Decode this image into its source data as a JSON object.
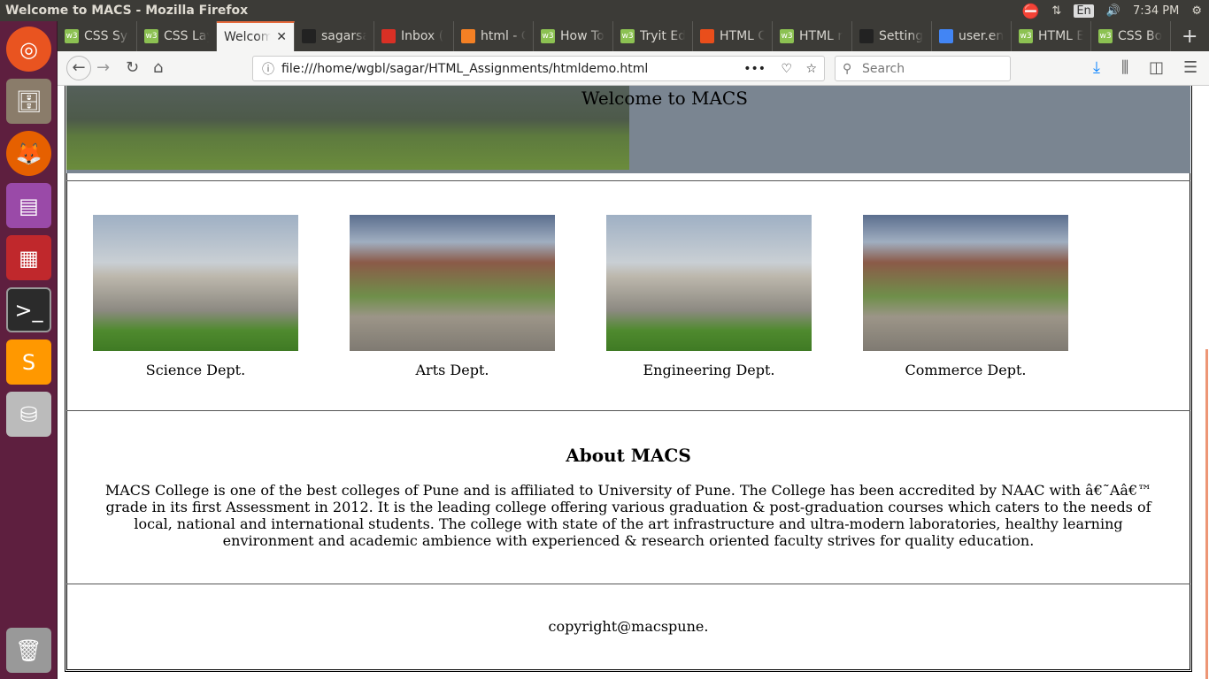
{
  "os": {
    "window_title": "Welcome to MACS - Mozilla Firefox",
    "keyboard": "En",
    "time": "7:34 PM"
  },
  "browser": {
    "tabs": [
      {
        "label": "CSS Syn",
        "icon": "w3schools-icon",
        "color": "#8cc152"
      },
      {
        "label": "CSS Lay",
        "icon": "w3schools-icon",
        "color": "#8cc152"
      },
      {
        "label": "Welcom",
        "icon": "",
        "active": true
      },
      {
        "label": "sagarsa",
        "icon": "github-icon",
        "color": "#222"
      },
      {
        "label": "Inbox (",
        "icon": "gmail-icon",
        "color": "#d93025"
      },
      {
        "label": "html - C",
        "icon": "stackoverflow-icon",
        "color": "#f48024"
      },
      {
        "label": "How To",
        "icon": "w3schools-icon",
        "color": "#8cc152"
      },
      {
        "label": "Tryit Ed",
        "icon": "w3schools-icon",
        "color": "#8cc152"
      },
      {
        "label": "HTML C",
        "icon": "opera-icon",
        "color": "#e94e1b"
      },
      {
        "label": "HTML r",
        "icon": "w3schools-icon",
        "color": "#8cc152"
      },
      {
        "label": "Setting",
        "icon": "github-icon",
        "color": "#222"
      },
      {
        "label": "user.en",
        "icon": "google-icon",
        "color": "#4285f4"
      },
      {
        "label": "HTML E",
        "icon": "w3schools-icon",
        "color": "#8cc152"
      },
      {
        "label": "CSS Bo",
        "icon": "w3schools-icon",
        "color": "#8cc152"
      }
    ],
    "url": "file:///home/wgbl/sagar/HTML_Assignments/htmldemo.html",
    "search_placeholder": "Search"
  },
  "page": {
    "title": "Welcome to MACS",
    "departments": [
      {
        "name": "Science Dept.",
        "image": "dome"
      },
      {
        "name": "Arts Dept.",
        "image": "campus"
      },
      {
        "name": "Engineering Dept.",
        "image": "dome"
      },
      {
        "name": "Commerce Dept.",
        "image": "campus"
      }
    ],
    "about_heading": "About MACS",
    "about_text": "MACS College is one of the best colleges of Pune and is affiliated to University of Pune. The College has been accredited by NAAC with â€˜Aâ€™ grade in its first Assessment in 2012. It is the leading college offering various graduation & post-graduation courses which caters to the needs of local, national and international students. The college with state of the art infrastructure and ultra-modern laboratories, healthy learning environment and academic ambience with experienced & research oriented faculty strives for quality education.",
    "copyright": "copyright@macspune."
  }
}
